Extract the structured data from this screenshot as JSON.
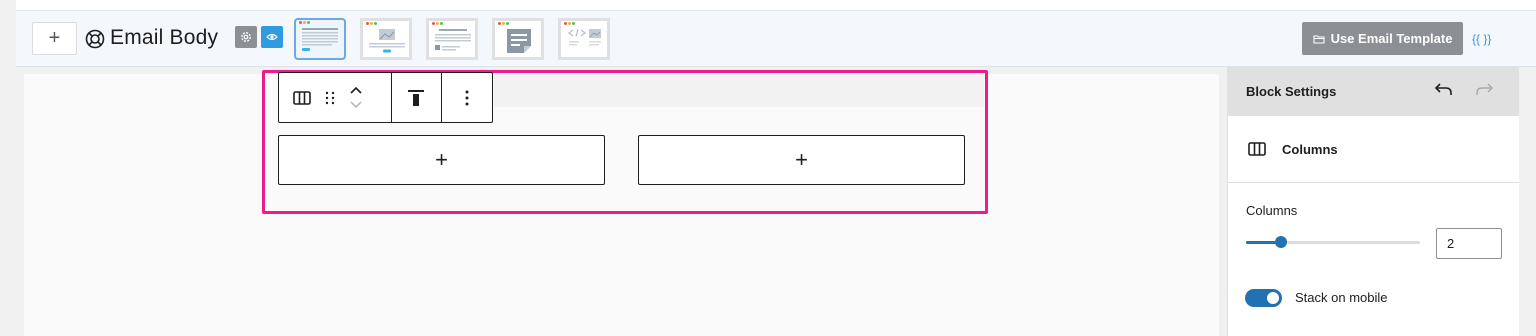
{
  "header": {
    "add_label": "+",
    "title": "Email Body",
    "use_template_label": "Use Email Template",
    "merge_tags_label": "{{ }}",
    "accent": "#2f9ce0"
  },
  "templates": [
    {
      "name": "template-text-layout",
      "active": true
    },
    {
      "name": "template-image-layout",
      "active": false
    },
    {
      "name": "template-article-layout",
      "active": false
    },
    {
      "name": "template-note-layout",
      "active": false
    },
    {
      "name": "template-code-layout",
      "active": false
    }
  ],
  "toolbar": {
    "icons": [
      "columns-icon",
      "drag-handle-icon",
      "move-up-icon",
      "move-down-icon",
      "align-top-icon",
      "more-options-icon"
    ]
  },
  "canvas": {
    "column_placeholder_label": "+",
    "selection_color": "#e91e8c"
  },
  "sidebar": {
    "title": "Block Settings",
    "block_name": "Columns",
    "columns_label": "Columns",
    "columns_value": "2",
    "slider_fraction": 0.2,
    "stack_label": "Stack on mobile",
    "stack_enabled": true,
    "accent": "#2271b1"
  }
}
